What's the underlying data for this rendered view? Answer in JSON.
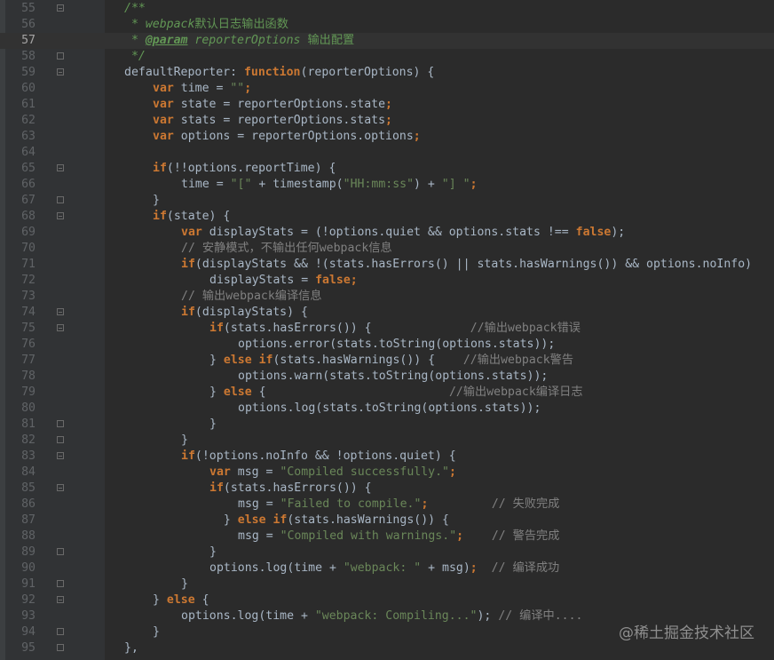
{
  "editor": {
    "first_line": 55,
    "active_line": 57,
    "colors": {
      "background": "#2b2b2b",
      "gutter": "#313335",
      "keyword": "#cc7832",
      "string": "#6a8759",
      "comment": "#808080",
      "doc_comment": "#629755",
      "function_name": "#ffc66d",
      "default_text": "#a9b7c6"
    },
    "lines": [
      {
        "n": "55",
        "indent": 0,
        "fold": "close",
        "tokens": [
          {
            "t": "/**",
            "c": "doc"
          }
        ]
      },
      {
        "n": "56",
        "indent": 0,
        "fold": "",
        "tokens": [
          {
            "t": " * webpack",
            "c": "doc"
          },
          {
            "t": "默认日志输出函数",
            "c": "docb"
          }
        ]
      },
      {
        "n": "57",
        "indent": 0,
        "fold": "",
        "tokens": [
          {
            "t": " * ",
            "c": "doc"
          },
          {
            "t": "@param",
            "c": "tag"
          },
          {
            "t": " reporterOptions ",
            "c": "doc"
          },
          {
            "t": "输出配置",
            "c": "docb"
          }
        ]
      },
      {
        "n": "58",
        "indent": 0,
        "fold": "open",
        "tokens": [
          {
            "t": " */",
            "c": "doc"
          }
        ]
      },
      {
        "n": "59",
        "indent": 0,
        "fold": "close",
        "tokens": [
          {
            "t": "defaultReporter: ",
            "c": ""
          },
          {
            "t": "function",
            "c": "kw"
          },
          {
            "t": "(reporterOptions) {",
            "c": ""
          }
        ]
      },
      {
        "n": "60",
        "indent": 1,
        "fold": "",
        "tokens": [
          {
            "t": "var",
            "c": "kw"
          },
          {
            "t": " time = ",
            "c": ""
          },
          {
            "t": "\"\"",
            "c": "str"
          },
          {
            "t": ";",
            "c": "kw"
          }
        ]
      },
      {
        "n": "61",
        "indent": 1,
        "fold": "",
        "tokens": [
          {
            "t": "var",
            "c": "kw"
          },
          {
            "t": " state = reporterOptions.state",
            "c": ""
          },
          {
            "t": ";",
            "c": "kw"
          }
        ]
      },
      {
        "n": "62",
        "indent": 1,
        "fold": "",
        "tokens": [
          {
            "t": "var",
            "c": "kw"
          },
          {
            "t": " stats = reporterOptions.stats",
            "c": ""
          },
          {
            "t": ";",
            "c": "kw"
          }
        ]
      },
      {
        "n": "63",
        "indent": 1,
        "fold": "",
        "tokens": [
          {
            "t": "var",
            "c": "kw"
          },
          {
            "t": " options = reporterOptions.options",
            "c": ""
          },
          {
            "t": ";",
            "c": "kw"
          }
        ]
      },
      {
        "n": "64",
        "indent": 0,
        "fold": "",
        "tokens": []
      },
      {
        "n": "65",
        "indent": 1,
        "fold": "close",
        "tokens": [
          {
            "t": "if",
            "c": "kw"
          },
          {
            "t": "(!!options.reportTime) {",
            "c": ""
          }
        ]
      },
      {
        "n": "66",
        "indent": 2,
        "fold": "",
        "tokens": [
          {
            "t": "time = ",
            "c": ""
          },
          {
            "t": "\"[\"",
            "c": "str"
          },
          {
            "t": " + timestamp(",
            "c": ""
          },
          {
            "t": "\"HH:mm:ss\"",
            "c": "str"
          },
          {
            "t": ") + ",
            "c": ""
          },
          {
            "t": "\"] \"",
            "c": "str"
          },
          {
            "t": ";",
            "c": "kw"
          }
        ]
      },
      {
        "n": "67",
        "indent": 1,
        "fold": "open",
        "tokens": [
          {
            "t": "}",
            "c": ""
          }
        ]
      },
      {
        "n": "68",
        "indent": 1,
        "fold": "close",
        "tokens": [
          {
            "t": "if",
            "c": "kw"
          },
          {
            "t": "(state) {",
            "c": ""
          }
        ]
      },
      {
        "n": "69",
        "indent": 2,
        "fold": "",
        "tokens": [
          {
            "t": "var",
            "c": "kw"
          },
          {
            "t": " displayStats = (!options.quiet && options.stats !== ",
            "c": ""
          },
          {
            "t": "false",
            "c": "kw"
          },
          {
            "t": ");",
            "c": ""
          }
        ]
      },
      {
        "n": "70",
        "indent": 2,
        "fold": "",
        "tokens": [
          {
            "t": "// 安静模式，不输出任何webpack信息",
            "c": "cm"
          }
        ]
      },
      {
        "n": "71",
        "indent": 2,
        "fold": "",
        "tokens": [
          {
            "t": "if",
            "c": "kw"
          },
          {
            "t": "(displayStats && !(stats.hasErrors() || stats.hasWarnings()) && options.noInfo)",
            "c": ""
          }
        ]
      },
      {
        "n": "72",
        "indent": 3,
        "fold": "",
        "tokens": [
          {
            "t": "displayStats = ",
            "c": ""
          },
          {
            "t": "false",
            "c": "kw"
          },
          {
            "t": ";",
            "c": "kw"
          }
        ]
      },
      {
        "n": "73",
        "indent": 2,
        "fold": "",
        "tokens": [
          {
            "t": "// 输出webpack编译信息",
            "c": "cm"
          }
        ]
      },
      {
        "n": "74",
        "indent": 2,
        "fold": "close",
        "tokens": [
          {
            "t": "if",
            "c": "kw"
          },
          {
            "t": "(displayStats) {",
            "c": ""
          }
        ]
      },
      {
        "n": "75",
        "indent": 3,
        "fold": "close",
        "tokens": [
          {
            "t": "if",
            "c": "kw"
          },
          {
            "t": "(stats.hasErrors()) {              ",
            "c": ""
          },
          {
            "t": "//输出webpack错误",
            "c": "cm"
          }
        ]
      },
      {
        "n": "76",
        "indent": 4,
        "fold": "",
        "tokens": [
          {
            "t": "options.error(stats.toString(options.stats));",
            "c": ""
          }
        ]
      },
      {
        "n": "77",
        "indent": 3,
        "fold": "",
        "tokens": [
          {
            "t": "} ",
            "c": ""
          },
          {
            "t": "else if",
            "c": "kw"
          },
          {
            "t": "(stats.hasWarnings()) {    ",
            "c": ""
          },
          {
            "t": "//输出webpack警告",
            "c": "cm"
          }
        ]
      },
      {
        "n": "78",
        "indent": 4,
        "fold": "",
        "tokens": [
          {
            "t": "options.warn(stats.toString(options.stats));",
            "c": ""
          }
        ]
      },
      {
        "n": "79",
        "indent": 3,
        "fold": "",
        "tokens": [
          {
            "t": "} ",
            "c": ""
          },
          {
            "t": "else",
            "c": "kw"
          },
          {
            "t": " {                          ",
            "c": ""
          },
          {
            "t": "//输出webpack编译日志",
            "c": "cm"
          }
        ]
      },
      {
        "n": "80",
        "indent": 4,
        "fold": "",
        "tokens": [
          {
            "t": "options.log(stats.toString(options.stats));",
            "c": ""
          }
        ]
      },
      {
        "n": "81",
        "indent": 3,
        "fold": "open",
        "tokens": [
          {
            "t": "}",
            "c": ""
          }
        ]
      },
      {
        "n": "82",
        "indent": 2,
        "fold": "open",
        "tokens": [
          {
            "t": "}",
            "c": ""
          }
        ]
      },
      {
        "n": "83",
        "indent": 2,
        "fold": "close",
        "tokens": [
          {
            "t": "if",
            "c": "kw"
          },
          {
            "t": "(!options.noInfo && !options.quiet) {",
            "c": ""
          }
        ]
      },
      {
        "n": "84",
        "indent": 3,
        "fold": "",
        "tokens": [
          {
            "t": "var",
            "c": "kw"
          },
          {
            "t": " msg = ",
            "c": ""
          },
          {
            "t": "\"Compiled successfully.\"",
            "c": "str"
          },
          {
            "t": ";",
            "c": "kw"
          }
        ]
      },
      {
        "n": "85",
        "indent": 3,
        "fold": "close",
        "tokens": [
          {
            "t": "if",
            "c": "kw"
          },
          {
            "t": "(stats.hasErrors()) {",
            "c": ""
          }
        ]
      },
      {
        "n": "86",
        "indent": 4,
        "fold": "",
        "tokens": [
          {
            "t": "msg = ",
            "c": ""
          },
          {
            "t": "\"Failed to compile.\"",
            "c": "str"
          },
          {
            "t": ";",
            "c": "kw"
          },
          {
            "t": "         ",
            "c": ""
          },
          {
            "t": "// 失败完成",
            "c": "cm"
          }
        ]
      },
      {
        "n": "87",
        "indent": 3,
        "fold": "",
        "tokens": [
          {
            "t": "  } ",
            "c": ""
          },
          {
            "t": "else if",
            "c": "kw"
          },
          {
            "t": "(stats.hasWarnings()) {",
            "c": ""
          }
        ]
      },
      {
        "n": "88",
        "indent": 4,
        "fold": "",
        "tokens": [
          {
            "t": "msg = ",
            "c": ""
          },
          {
            "t": "\"Compiled with warnings.\"",
            "c": "str"
          },
          {
            "t": ";",
            "c": "kw"
          },
          {
            "t": "    ",
            "c": ""
          },
          {
            "t": "// 警告完成",
            "c": "cm"
          }
        ]
      },
      {
        "n": "89",
        "indent": 3,
        "fold": "open",
        "tokens": [
          {
            "t": "}",
            "c": ""
          }
        ]
      },
      {
        "n": "90",
        "indent": 3,
        "fold": "",
        "tokens": [
          {
            "t": "options.log(time + ",
            "c": ""
          },
          {
            "t": "\"webpack: \"",
            "c": "str"
          },
          {
            "t": " + msg)",
            "c": ""
          },
          {
            "t": ";",
            "c": "kw"
          },
          {
            "t": "  ",
            "c": ""
          },
          {
            "t": "// 编译成功",
            "c": "cm"
          }
        ]
      },
      {
        "n": "91",
        "indent": 2,
        "fold": "open",
        "tokens": [
          {
            "t": "}",
            "c": ""
          }
        ]
      },
      {
        "n": "92",
        "indent": 1,
        "fold": "close",
        "tokens": [
          {
            "t": "} ",
            "c": ""
          },
          {
            "t": "else",
            "c": "kw"
          },
          {
            "t": " {",
            "c": ""
          }
        ]
      },
      {
        "n": "93",
        "indent": 2,
        "fold": "",
        "tokens": [
          {
            "t": "options.log(time + ",
            "c": ""
          },
          {
            "t": "\"webpack: Compiling...\"",
            "c": "str"
          },
          {
            "t": "); ",
            "c": ""
          },
          {
            "t": "// 编译中....",
            "c": "cm"
          }
        ]
      },
      {
        "n": "94",
        "indent": 1,
        "fold": "open",
        "tokens": [
          {
            "t": "}",
            "c": ""
          }
        ]
      },
      {
        "n": "95",
        "indent": 0,
        "fold": "open",
        "tokens": [
          {
            "t": "},",
            "c": ""
          }
        ]
      }
    ]
  },
  "watermark": "@稀土掘金技术社区"
}
